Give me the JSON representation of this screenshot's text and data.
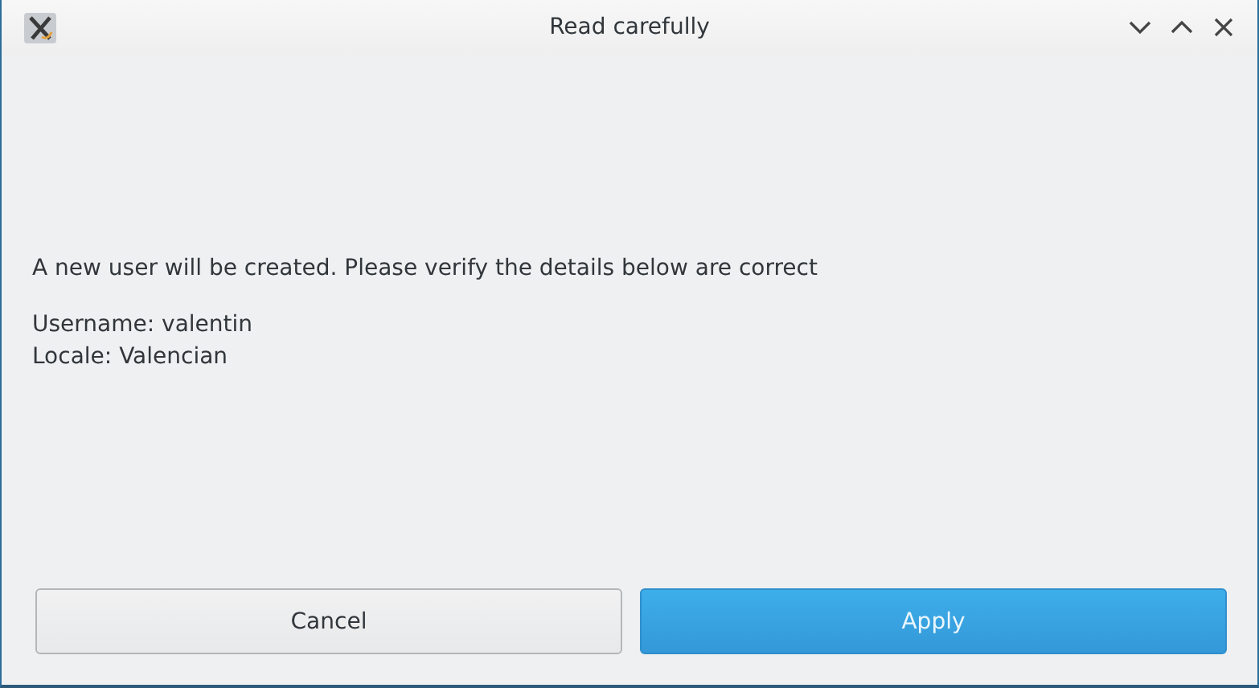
{
  "window": {
    "title": "Read carefully"
  },
  "message": "A new user will be created. Please verify the details below are correct",
  "details": [
    "Username: valentin",
    "Locale: Valencian"
  ],
  "buttons": [
    {
      "label": "Cancel",
      "default": false
    },
    {
      "label": "Apply",
      "default": true
    }
  ]
}
